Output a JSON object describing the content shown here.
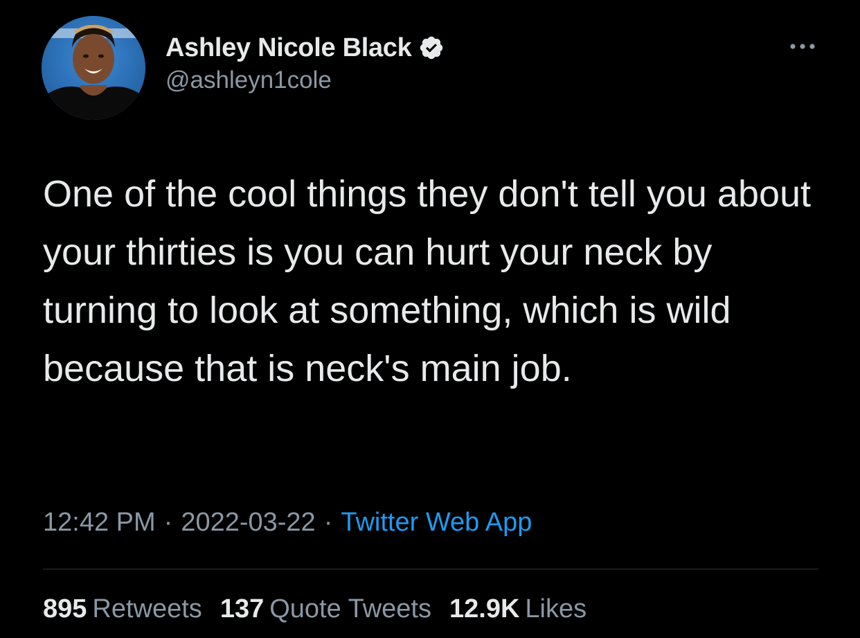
{
  "author": {
    "display_name": "Ashley Nicole Black",
    "handle": "@ashleyn1cole",
    "verified": true
  },
  "tweet": {
    "text": "One of the cool things they don't tell you about your thirties is you can hurt your neck by turning to look at something, which is wild because that is neck's main job."
  },
  "meta": {
    "time": "12:42 PM",
    "separator": "·",
    "date": "2022-03-22",
    "source": "Twitter Web App"
  },
  "stats": {
    "retweets_count": "895",
    "retweets_label": "Retweets",
    "quotes_count": "137",
    "quotes_label": "Quote Tweets",
    "likes_count": "12.9K",
    "likes_label": "Likes"
  },
  "icons": {
    "verified": "verified-badge-icon",
    "more": "more-options-icon"
  },
  "colors": {
    "background": "#000000",
    "text_primary": "#e7e9ea",
    "text_secondary": "#8b98a5",
    "link": "#1d9bf0",
    "divider": "#2f3336"
  }
}
